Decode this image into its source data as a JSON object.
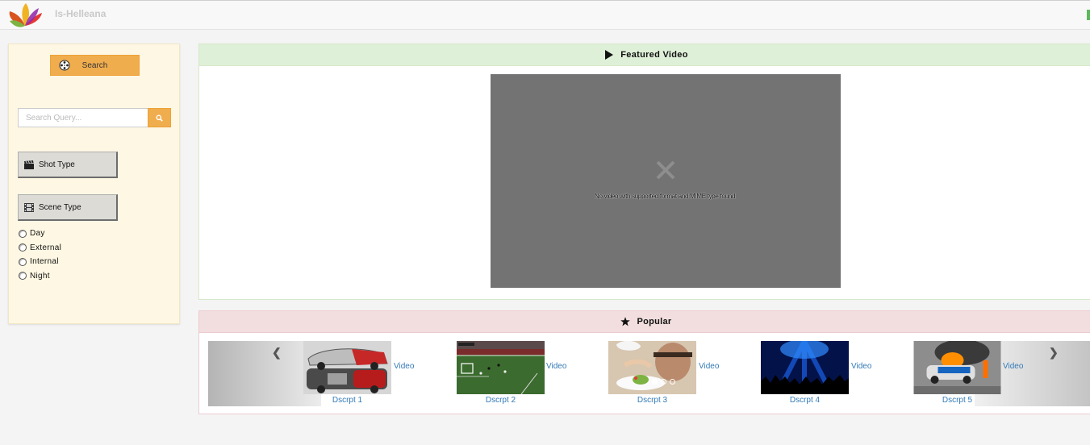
{
  "header": {
    "brand": "Is-Helleana",
    "logo_icon": "leaf-flower-logo-icon",
    "accent_green": "#5cb85c"
  },
  "sidebar": {
    "search_button_label": "Search",
    "search_button_icon": "film-reel-icon",
    "query_placeholder": "Search Query...",
    "query_value": "",
    "query_submit_icon": "search-icon",
    "shot_type_label": "Shot Type",
    "scene_type_label": "Scene Type",
    "scene_options": [
      {
        "label": "Day",
        "checked": false
      },
      {
        "label": "External",
        "checked": false
      },
      {
        "label": "Internal",
        "checked": false
      },
      {
        "label": "Night",
        "checked": false
      }
    ],
    "colors": {
      "background": "#fdf7e3",
      "accent": "#f0ad4e"
    }
  },
  "featured": {
    "title": "Featured Video",
    "title_icon": "play-icon",
    "player_error": "No video with supported format and MIME type found.",
    "player_icon": "close-x-icon"
  },
  "popular": {
    "title": "Popular",
    "title_icon": "star-icon",
    "items": [
      {
        "link": "Video",
        "caption": "Dscrpt 1",
        "thumb": "race-car-cutaway"
      },
      {
        "link": "Video",
        "caption": "Dscrpt 2",
        "thumb": "football-match"
      },
      {
        "link": "Video",
        "caption": "Dscrpt 3",
        "thumb": "chef-plating"
      },
      {
        "link": "Video",
        "caption": "Dscrpt 4",
        "thumb": "concert-crowd"
      },
      {
        "link": "Video",
        "caption": "Dscrpt 5",
        "thumb": "burning-rally-car"
      }
    ],
    "active_slide": 1,
    "slide_count": 3
  }
}
